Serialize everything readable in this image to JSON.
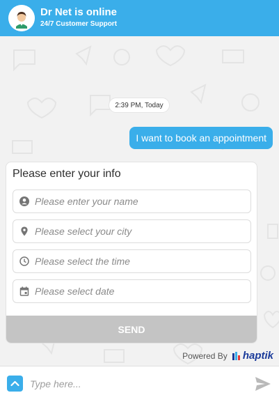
{
  "header": {
    "title": "Dr Net is online",
    "subtitle": "24/7 Customer Support",
    "avatar_icon": "doctor-avatar-icon",
    "color": "#3aaeea"
  },
  "chat": {
    "timestamp": "2:39 PM, Today",
    "user_message": "I want to book an appointment"
  },
  "form": {
    "title": "Please enter your info",
    "fields": [
      {
        "placeholder": "Please enter your name",
        "icon": "person-icon"
      },
      {
        "placeholder": "Please select your city",
        "icon": "location-pin-icon"
      },
      {
        "placeholder": "Please select the time",
        "icon": "clock-icon"
      },
      {
        "placeholder": "Please select date",
        "icon": "calendar-icon"
      }
    ],
    "submit_label": "SEND"
  },
  "branding": {
    "powered_by": "Powered By",
    "brand": "haptik"
  },
  "composer": {
    "placeholder": "Type here...",
    "menu_icon": "chevron-up-icon",
    "send_icon": "send-icon"
  }
}
